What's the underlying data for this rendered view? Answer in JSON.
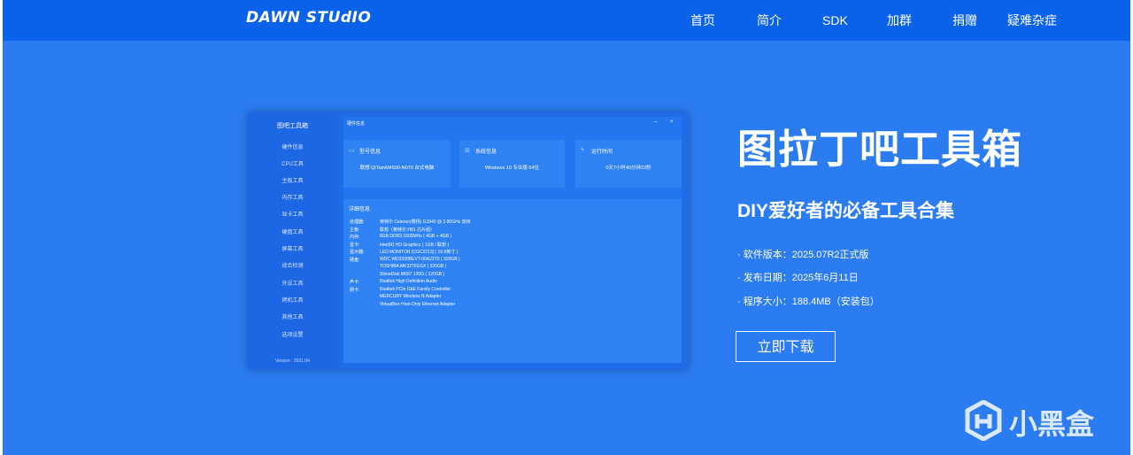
{
  "header": {
    "logo_text": "DAWN STUdIO",
    "nav": [
      "首页",
      "简介",
      "SDK",
      "加群",
      "捐赠",
      "疑难杂症"
    ]
  },
  "screenshot": {
    "sidebar_title": "图吧工具箱",
    "sidebar_items": [
      "硬件信息",
      "CPU工具",
      "主板工具",
      "内存工具",
      "显卡工具",
      "硬盘工具",
      "屏幕工具",
      "综合检测",
      "外设工具",
      "烤机工具",
      "其他工具",
      "选项设置"
    ],
    "version": "Version : 2021.04",
    "window_title": "硬件信息",
    "window_controls": [
      "–",
      "×"
    ],
    "cards": [
      {
        "title": "型号信息",
        "value": "联想 QiTianM4500-N070 台式电脑",
        "icon": "monitor-icon"
      },
      {
        "title": "系统信息",
        "value": "Windows 10 专业版 64位",
        "icon": "windows-icon"
      },
      {
        "title": "运行时间",
        "value": "0天7小时40分钟22秒",
        "icon": "lightning-icon"
      }
    ],
    "detail_title": "详细信息",
    "details": [
      {
        "label": "处理器:",
        "value": "英特尔 Celeron(赛扬) G1840 @ 2.80GHz 双核"
      },
      {
        "label": "主板:",
        "value": "联想（英特尔 H81 芯片组）"
      },
      {
        "label": "内存:",
        "value": "8GB DDR3 1600MHz ( 4GB + 4GB )"
      },
      {
        "label": "显卡:",
        "value": "Intel(R) HD Graphics ( 1GB / 联想 )"
      },
      {
        "label": "显示器:",
        "value": "LED MONITOR [CGC2213] ( 19.9英寸 )"
      },
      {
        "label": "硬盘:",
        "value": "WDC WD3200BEVT-00A23T0 ( 320GB )"
      },
      {
        "label": "",
        "value": "TOSHIBA MK3276GSX ( 320GB )"
      },
      {
        "label": "",
        "value": "ShineDisk M667 120G ( 120GB )"
      },
      {
        "label": "声卡:",
        "value": "Realtek High Definition Audio"
      },
      {
        "label": "网卡:",
        "value": "Realtek PCIe GbE Family Controller"
      },
      {
        "label": "",
        "value": "MERCURY Wireless N Adapter"
      },
      {
        "label": "",
        "value": "VirtualBox Host-Only Ethernet Adapter"
      }
    ]
  },
  "hero": {
    "title": "图拉丁吧工具箱",
    "subtitle": "DIY爱好者的必备工具合集",
    "info": [
      "· 软件版本：2025.07R2正式版",
      "· 发布日期：2025年6月11日",
      "· 程序大小：188.4MB（安装包）"
    ],
    "download_label": "立即下载"
  },
  "watermark": {
    "text": "小黑盒",
    "icon": "heybox-logo-icon"
  },
  "colors": {
    "background": "#2b7cf0",
    "topbar": "#0a62ea",
    "text": "#ffffff"
  }
}
